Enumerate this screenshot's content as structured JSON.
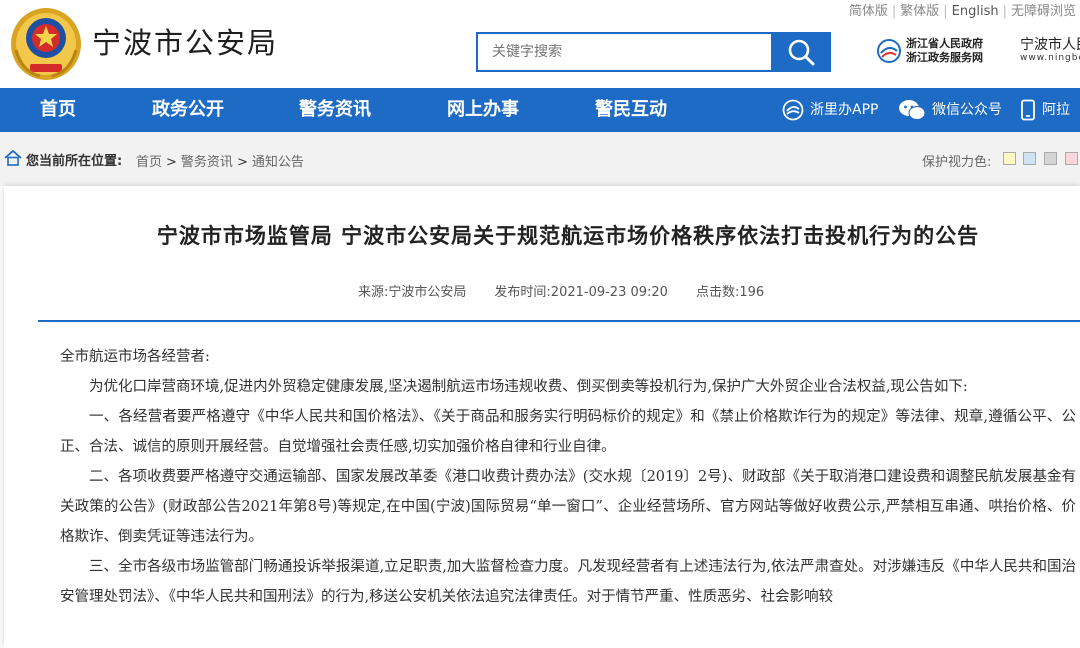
{
  "header": {
    "site_title": "宁波市公安局",
    "search_placeholder": "关键字搜索",
    "util_links": [
      "简体版",
      "繁体版",
      "English",
      "无障碍浏览"
    ],
    "partner_zj_line1": "浙江省人民政府",
    "partner_zj_line2": "浙江政务服务网",
    "partner_nb": "宁波市人民",
    "partner_nb_sub": "www.ningbo"
  },
  "nav": {
    "items": [
      "首页",
      "政务公开",
      "警务资讯",
      "网上办事",
      "警民互动"
    ],
    "right": [
      "浙里办APP",
      "微信公众号",
      "阿拉"
    ]
  },
  "breadcrumb": {
    "label": "您当前所在位置:",
    "path": [
      "首页",
      "警务资讯",
      "通知公告"
    ],
    "eye_label": "保护视力色:",
    "swatches": [
      "#fff9c4",
      "#cfe3f5",
      "#d5d5d5",
      "#fbd7dc"
    ]
  },
  "article": {
    "title": "宁波市市场监管局 宁波市公安局关于规范航运市场价格秩序依法打击投机行为的公告",
    "source_label": "来源:",
    "source": "宁波市公安局",
    "time_label": "发布时间:",
    "time": "2021-09-23 09:20",
    "hits_label": "点击数:",
    "hits": "196",
    "paragraphs": [
      "全市航运市场各经营者:",
      "为优化口岸营商环境,促进内外贸稳定健康发展,坚决遏制航运市场违规收费、倒买倒卖等投机行为,保护广大外贸企业合法权益,现公告如下:",
      "一、各经营者要严格遵守《中华人民共和国价格法》、《关于商品和服务实行明码标价的规定》和《禁止价格欺诈行为的规定》等法律、规章,遵循公平、公正、合法、诚信的原则开展经营。自觉增强社会责任感,切实加强价格自律和行业自律。",
      "二、各项收费要严格遵守交通运输部、国家发展改革委《港口收费计费办法》(交水规〔2019〕2号)、财政部《关于取消港口建设费和调整民航发展基金有关政策的公告》(财政部公告2021年第8号)等规定,在中国(宁波)国际贸易“单一窗口”、企业经营场所、官方网站等做好收费公示,严禁相互串通、哄抬价格、价格欺诈、倒卖凭证等违法行为。",
      "三、全市各级市场监管部门畅通投诉举报渠道,立足职责,加大监督检查力度。凡发现经营者有上述违法行为,依法严肃查处。对涉嫌违反《中华人民共和国治安管理处罚法》、《中华人民共和国刑法》的行为,移送公安机关依法追究法律责任。对于情节严重、性质恶劣、社会影响较"
    ]
  },
  "colors": {
    "brand_blue": "#1d6bc4",
    "crumb_bg": "#f2f2f2"
  }
}
